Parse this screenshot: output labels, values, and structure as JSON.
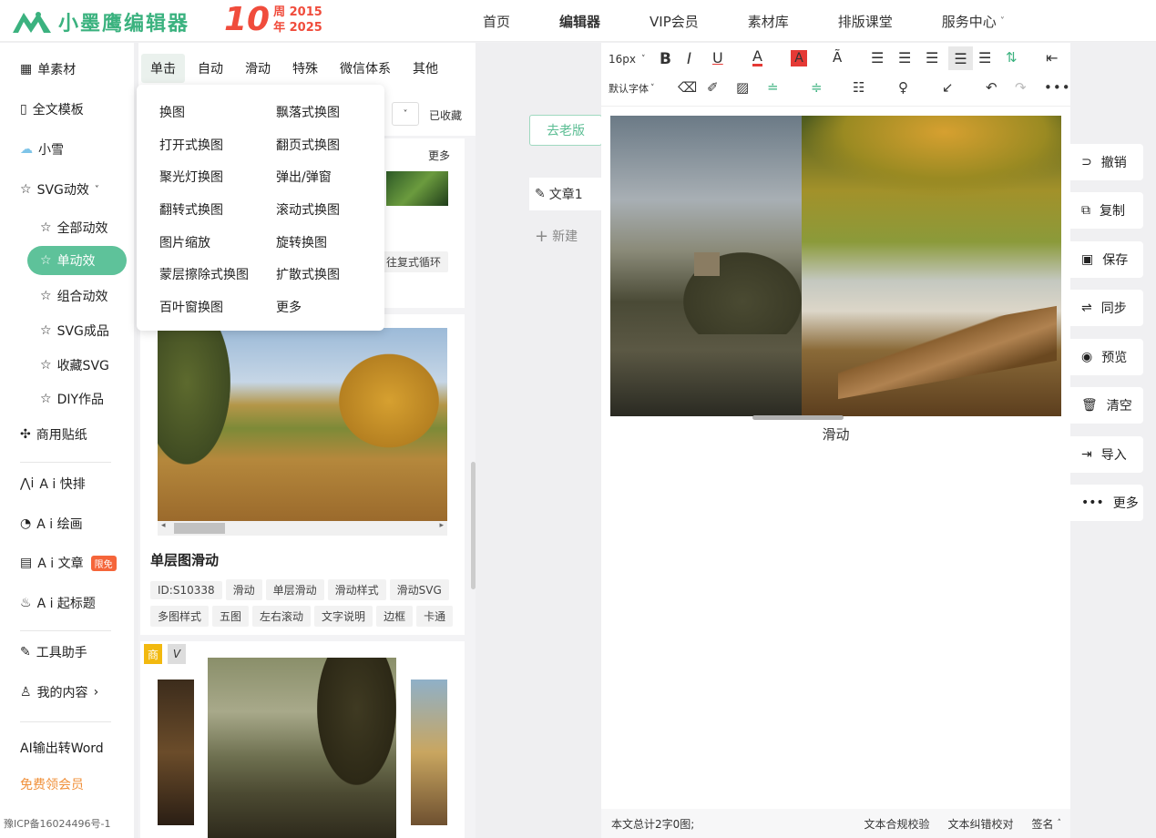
{
  "header": {
    "logo_text": "小墨鹰编辑器",
    "anniv_number": "10",
    "anniv_line1": "周 2015",
    "anniv_line2": "年 2025",
    "nav": [
      "首页",
      "编辑器",
      "VIP会员",
      "素材库",
      "排版课堂",
      "服务中心"
    ],
    "nav_active": "编辑器",
    "service_chevron": "˅"
  },
  "sidebar": {
    "items": [
      {
        "label": "单素材",
        "icon": "grid-icon"
      },
      {
        "label": "全文模板",
        "icon": "template-icon"
      },
      {
        "label": "小雪",
        "icon": "cloud-icon"
      },
      {
        "label": "SVG动效",
        "icon": "star-icon"
      },
      {
        "label": "全部动效",
        "icon": "star-icon"
      },
      {
        "label": "单动效",
        "icon": "star-icon"
      },
      {
        "label": "组合动效",
        "icon": "star-icon"
      },
      {
        "label": "SVG成品",
        "icon": "star-icon"
      },
      {
        "label": "收藏SVG",
        "icon": "star-icon"
      },
      {
        "label": "DIY作品",
        "icon": "star-icon"
      },
      {
        "label": "商用贴纸",
        "icon": "puzzle-icon"
      },
      {
        "label": "A i 快排",
        "icon": "ai-icon"
      },
      {
        "label": "A i 绘画",
        "icon": "palette-icon"
      },
      {
        "label": "A i 文章",
        "icon": "doc-icon"
      },
      {
        "label": "A i 起标题",
        "icon": "fire-icon"
      },
      {
        "label": "工具助手",
        "icon": "tool-icon"
      },
      {
        "label": "我的内容",
        "icon": "user-icon"
      },
      {
        "label": "AI输出转Word",
        "icon": ""
      },
      {
        "label": "免费领会员",
        "icon": ""
      }
    ],
    "limited_badge": "限免",
    "icp": "豫ICP备16024496号-1"
  },
  "material": {
    "tabs": [
      "单击",
      "自动",
      "滑动",
      "特殊",
      "微信体系",
      "其他"
    ],
    "active_tab": "单击",
    "collected": "已收藏",
    "more": "更多",
    "partial_tag": "往复式循环",
    "card_title": "单层图滑动",
    "tags": [
      "ID:S10338",
      "滑动",
      "单层滑动",
      "滑动样式",
      "滑动SVG",
      "多图样式",
      "五图",
      "左右滚动",
      "文字说明",
      "边框",
      "卡通"
    ],
    "badge_shang": "商",
    "badge_v": "V"
  },
  "dropdown": {
    "items": [
      "换图",
      "飘落式换图",
      "打开式换图",
      "翻页式换图",
      "聚光灯换图",
      "弹出/弹窗",
      "翻转式换图",
      "滚动式换图",
      "图片缩放",
      "旋转换图",
      "蒙层擦除式换图",
      "扩散式换图",
      "百叶窗换图",
      "更多"
    ]
  },
  "workarea": {
    "old_version": "去老版",
    "doc_tab": "文章1",
    "new_doc": "新建"
  },
  "editor": {
    "font_size": "16px",
    "font_family": "默认字体",
    "caption": "滑动",
    "word_count": "本文总计2字0图;",
    "compliance": "文本合规校验",
    "correction": "文本纠错校对",
    "signature": "签名",
    "colors": {
      "accent": "#5ec29a",
      "red": "#f04c3c",
      "font_red": "#e53935",
      "highlight": "#e53935",
      "underline": "#e53935"
    }
  },
  "right_actions": [
    "撤销",
    "复制",
    "保存",
    "同步",
    "预览",
    "清空",
    "导入",
    "更多"
  ]
}
